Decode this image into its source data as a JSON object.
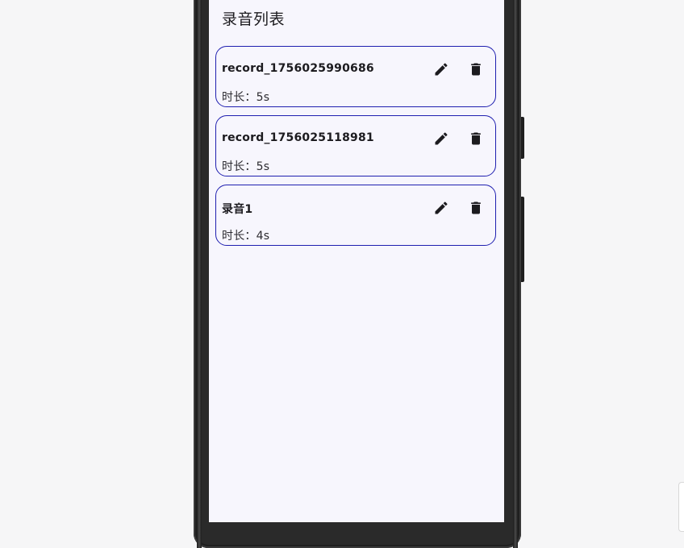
{
  "app": {
    "title": "录音列表"
  },
  "recordings": [
    {
      "name": "record_1756025990686",
      "duration": "时长：5s"
    },
    {
      "name": "record_1756025118981",
      "duration": "时长：5s"
    },
    {
      "name": "录音1",
      "duration": "时长：4s"
    }
  ],
  "icons": {
    "edit": "pencil-icon",
    "delete": "trash-icon"
  },
  "colors": {
    "card_border": "#1f1fb0",
    "screen_background": "#f7f6fd",
    "icon": "#1c1b1f"
  }
}
